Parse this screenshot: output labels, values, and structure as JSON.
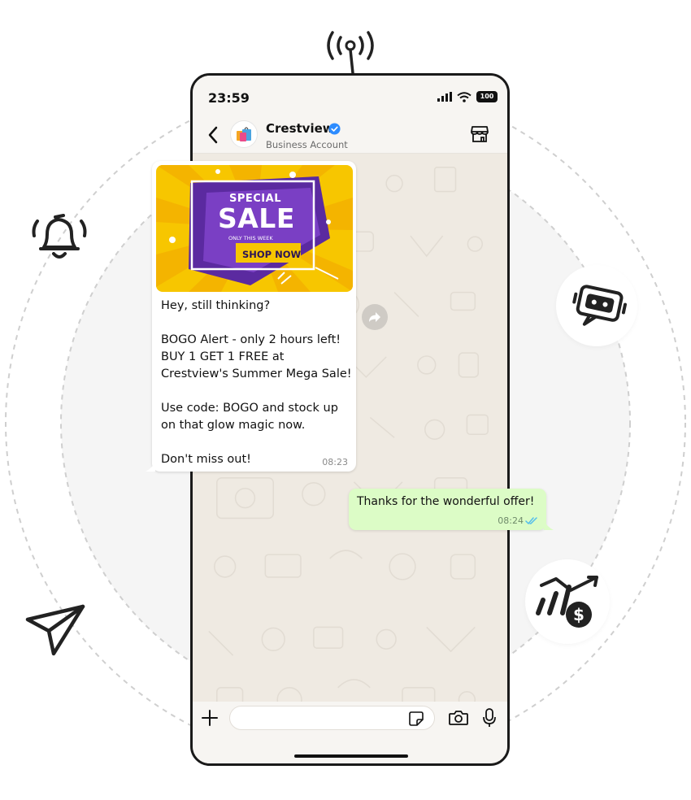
{
  "status_bar": {
    "time": "23:59",
    "battery": "100"
  },
  "chat_header": {
    "name": "Crestview",
    "subtitle": "Business Account"
  },
  "incoming_message": {
    "promo": {
      "line1": "SPECIAL",
      "line2": "SALE",
      "line3": "ONLY THIS WEEK",
      "cta": "SHOP NOW"
    },
    "paragraphs": [
      "Hey, still thinking?",
      "BOGO Alert - only 2 hours left! BUY 1 GET 1 FREE at Crestview's Summer Mega Sale!",
      "Use code: BOGO and stock up on that glow magic now.",
      "Don't miss out!"
    ],
    "time": "08:23"
  },
  "outgoing_message": {
    "text": "Thanks for the wonderful offer!",
    "time": "08:24",
    "status": "read"
  },
  "composer": {
    "placeholder": "",
    "value": ""
  },
  "colors": {
    "outgoing_bubble": "#dcfcc6",
    "chat_background": "#efeae2",
    "read_ticks": "#53bdeb",
    "verified_badge": "#2d8cff",
    "promo_yellow": "#f7c600",
    "promo_purple": "#5b2aa0"
  },
  "icons": [
    "broadcast-icon",
    "bell-icon",
    "bot-icon",
    "send-icon",
    "money-growth-icon",
    "back-icon",
    "verified-icon",
    "store-icon",
    "forward-icon",
    "plus-icon",
    "sticker-icon",
    "camera-icon",
    "mic-icon"
  ]
}
